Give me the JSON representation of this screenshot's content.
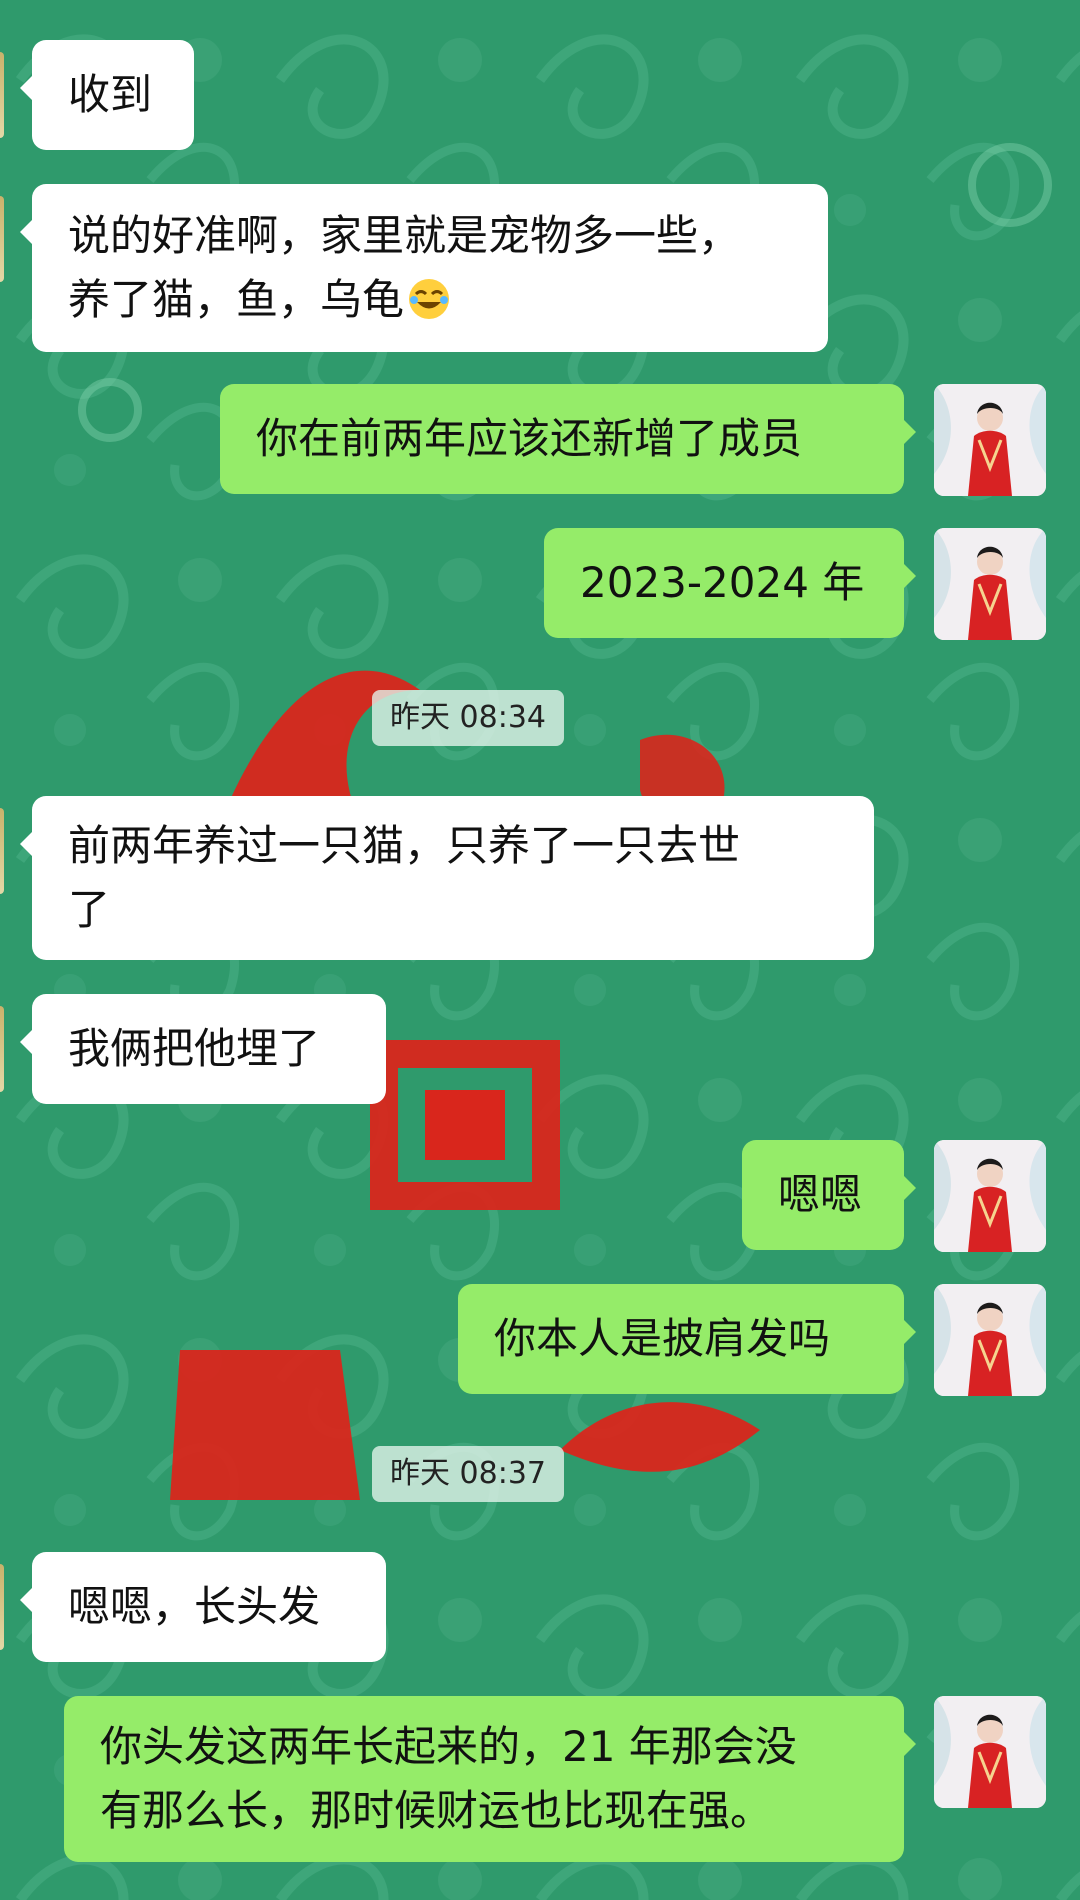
{
  "messages": [
    {
      "side": "in",
      "lines": [
        "收到"
      ]
    },
    {
      "side": "in",
      "lines": [
        "说的好准啊，家里就是宠物多一些，",
        "养了猫，鱼，乌龟"
      ],
      "emoji": "laughing-crying-emoji"
    },
    {
      "side": "out",
      "lines": [
        "你在前两年应该还新增了成员"
      ]
    },
    {
      "side": "out",
      "lines": [
        "2023-2024 年"
      ]
    },
    {
      "side": "time",
      "text": "昨天 08:34"
    },
    {
      "side": "in",
      "lines": [
        "前两年养过一只猫，只养了一只去世",
        "了"
      ]
    },
    {
      "side": "in",
      "lines": [
        "我俩把他埋了"
      ]
    },
    {
      "side": "out",
      "lines": [
        "嗯嗯"
      ]
    },
    {
      "side": "out",
      "lines": [
        "你本人是披肩发吗"
      ]
    },
    {
      "side": "time",
      "text": "昨天 08:37"
    },
    {
      "side": "in",
      "lines": [
        "嗯嗯，长头发"
      ]
    },
    {
      "side": "out",
      "lines": [
        "你头发这两年长起来的，21 年那会没",
        "有那么长，那时候财运也比现在强。"
      ]
    }
  ],
  "colors": {
    "background": "#2f9a6c",
    "incoming_bubble": "#ffffff",
    "outgoing_bubble": "#95ec69",
    "decoration_red": "#d9261c"
  },
  "avatar": {
    "icon": "user-avatar-red-costume"
  }
}
